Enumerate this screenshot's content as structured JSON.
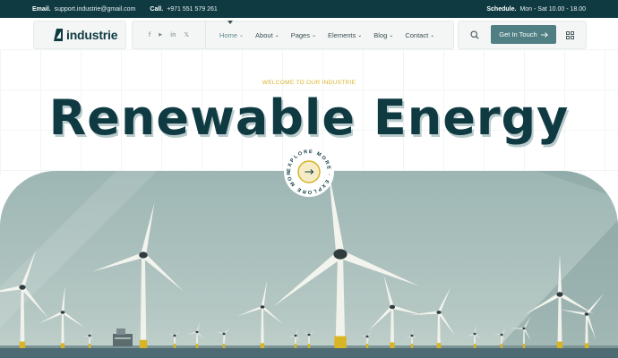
{
  "topbar": {
    "email_label": "Email.",
    "email_value": "support.industrie@gmail.com",
    "call_label": "Call.",
    "call_value": "+971 551 579 261",
    "schedule_label": "Schedule.",
    "schedule_value": "Mon - Sat 10.00 - 18.00"
  },
  "header": {
    "logo_text": "industrie",
    "socials": [
      {
        "icon": "facebook-icon",
        "glyph": "f"
      },
      {
        "icon": "youtube-icon",
        "glyph": "▶"
      },
      {
        "icon": "linkedin-icon",
        "glyph": "in"
      },
      {
        "icon": "x-twitter-icon",
        "glyph": "𝕏"
      }
    ],
    "menu": [
      {
        "label": "Home",
        "active": true
      },
      {
        "label": "About",
        "active": false
      },
      {
        "label": "Pages",
        "active": false
      },
      {
        "label": "Elements",
        "active": false
      },
      {
        "label": "Blog",
        "active": false
      },
      {
        "label": "Contact",
        "active": false
      }
    ],
    "cta_label": "Get In Touch",
    "cta_icon": "arrow-right-icon",
    "search_icon": "search-icon",
    "grid_icon": "grid-menu-icon"
  },
  "hero": {
    "eyebrow": "WELCOME TO OUR INDUSTRIE",
    "title": "Renewable Energy",
    "badge_text": "EXPLORE MORE · EXPLORE MORE ·",
    "badge_icon": "arrow-right-icon"
  },
  "colors": {
    "dark_teal": "#0f3a42",
    "accent_teal": "#4f7f82",
    "accent_yellow": "#d6b42a"
  }
}
